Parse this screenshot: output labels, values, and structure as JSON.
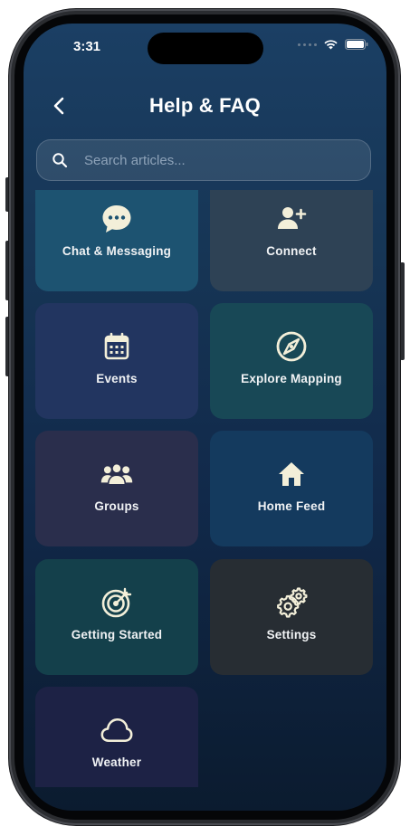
{
  "status_bar": {
    "time": "3:31"
  },
  "header": {
    "title": "Help & FAQ"
  },
  "search": {
    "placeholder": "Search articles..."
  },
  "categories": [
    {
      "label": "Chat & Messaging",
      "icon": "chat-bubble-icon",
      "color": "#1d5371"
    },
    {
      "label": "Connect",
      "icon": "add-user-icon",
      "color": "#2e4255"
    },
    {
      "label": "Events",
      "icon": "calendar-icon",
      "color": "#223560"
    },
    {
      "label": "Explore Mapping",
      "icon": "compass-icon",
      "color": "#184856"
    },
    {
      "label": "Groups",
      "icon": "people-group-icon",
      "color": "#2a2e4c"
    },
    {
      "label": "Home Feed",
      "icon": "home-icon",
      "color": "#143a5e"
    },
    {
      "label": "Getting Started",
      "icon": "target-icon",
      "color": "#14404b"
    },
    {
      "label": "Settings",
      "icon": "gears-icon",
      "color": "#272d33"
    },
    {
      "label": "Weather",
      "icon": "cloud-icon",
      "color": "#1d2245"
    }
  ],
  "colors": {
    "icon": "#f3efd9",
    "text": "#ffffff"
  }
}
